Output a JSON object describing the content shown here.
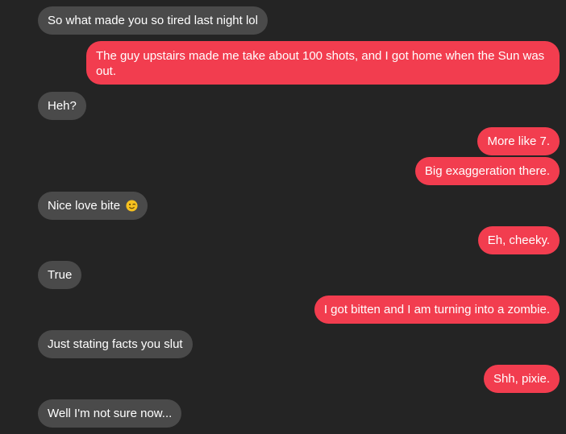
{
  "messages": [
    {
      "direction": "incoming",
      "text": "So what made you so tired last night lol"
    },
    {
      "direction": "outgoing",
      "text": "The guy upstairs made me take about 100 shots, and I got home when the Sun was out."
    },
    {
      "direction": "incoming",
      "text": "Heh?"
    },
    {
      "direction": "outgoing",
      "text": "More like 7."
    },
    {
      "direction": "outgoing",
      "text": "Big exaggeration there."
    },
    {
      "direction": "incoming",
      "text": "Nice love bite",
      "emoji": "winking-face-emoji"
    },
    {
      "direction": "outgoing",
      "text": "Eh, cheeky."
    },
    {
      "direction": "incoming",
      "text": "True"
    },
    {
      "direction": "outgoing",
      "text": "I got bitten and I am turning into a zombie."
    },
    {
      "direction": "incoming",
      "text": "Just stating facts you slut"
    },
    {
      "direction": "outgoing",
      "text": "Shh, pixie."
    },
    {
      "direction": "incoming",
      "text": "Well I'm not sure now..."
    }
  ],
  "colors": {
    "background": "#242424",
    "incoming_bubble": "#4a4a4a",
    "outgoing_bubble": "#f23d4f",
    "text": "#ffffff"
  }
}
